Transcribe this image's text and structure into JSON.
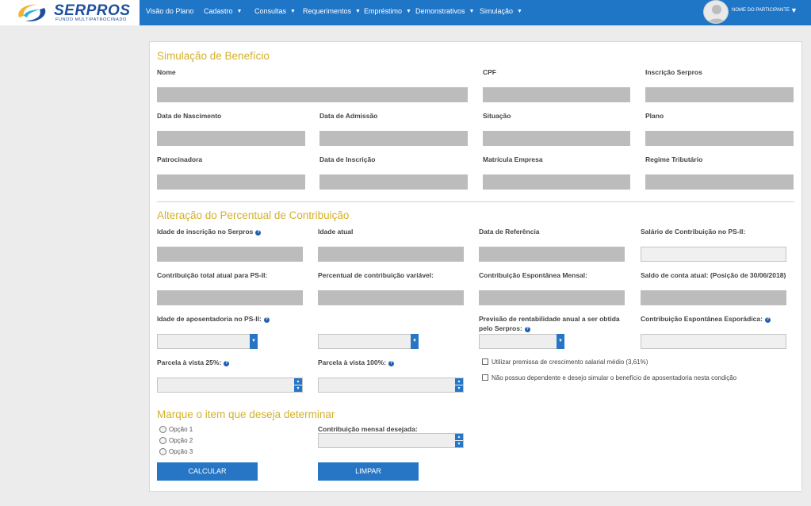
{
  "brand": {
    "name": "SERPROS",
    "tagline": "FUNDO MULTIPATROCINADO"
  },
  "nav": [
    {
      "label": "Visão do Plano",
      "has_caret": false
    },
    {
      "label": "Cadastro",
      "has_caret": true
    },
    {
      "label": "Consultas",
      "has_caret": true
    },
    {
      "label": "Requerimentos",
      "has_caret": true
    },
    {
      "label": "Empréstimo",
      "has_caret": true
    },
    {
      "label": "Demonstrativos",
      "has_caret": true
    },
    {
      "label": "Simulação",
      "has_caret": true
    }
  ],
  "user": {
    "name": "NOME DO PARTICIPANTE"
  },
  "colors": {
    "topbar": "#1f75c6",
    "accent": "#d3b12a",
    "button": "#2776c6",
    "field": "#bcbcbc"
  },
  "sections": {
    "beneficio": "Simulação de Benefício",
    "alteracao": "Alteração do Percentual de Contribuição",
    "determinar": "Marque o item que deseja determinar"
  },
  "beneficio_fields": {
    "nome": "Nome",
    "cpf": "CPF",
    "inscricao": "Inscrição Serpros",
    "nascimento": "Data de Nascimento",
    "admissao": "Data de Admissão",
    "situacao": "Situação",
    "plano": "Plano",
    "patrocinadora": "Patrocinadora",
    "data_inscricao": "Data de Inscrição",
    "matricula": "Matrícula Empresa",
    "regime": "Regime Tributário"
  },
  "alteracao_fields": {
    "idade_inscricao": "Idade de inscrição no Serpros",
    "idade_atual": "Idade atual",
    "data_referencia": "Data de Referência",
    "salario": "Salário de Contribuição no PS-II:",
    "contrib_total": "Contribuição total atual para PS-II:",
    "percentual_var": "Percentual de contribuição variável:",
    "espontanea_mensal": "Contribuição Espontânea Mensal:",
    "saldo_conta": "Saldo de conta atual: (Posição de 30/06/2018)",
    "idade_aposentadoria": "Idade de aposentadoria no PS-II:",
    "previsao": "Previsão de rentabilidade anual a ser obtida pelo Serpros:",
    "espontanea_esporadica": "Contribuição Espontânea Esporádica:",
    "parcela_25": "Parcela à vista 25%:",
    "parcela_100": "Parcela à vista 100%:"
  },
  "checkboxes": {
    "premissa": "Utilizar premissa de crescimento salarial médio (3,61%)",
    "dependente": "Não possuo dependente e desejo simular o benefício de aposentadoria nesta condição"
  },
  "options": [
    "Opção 1",
    "Opção 2",
    "Opção 3"
  ],
  "contrib_desejada": "Contribuição mensal desejada:",
  "buttons": {
    "calcular": "CALCULAR",
    "limpar": "LIMPAR"
  },
  "icons": {
    "help": "help-icon",
    "dropdown": "chevron-down-icon"
  }
}
